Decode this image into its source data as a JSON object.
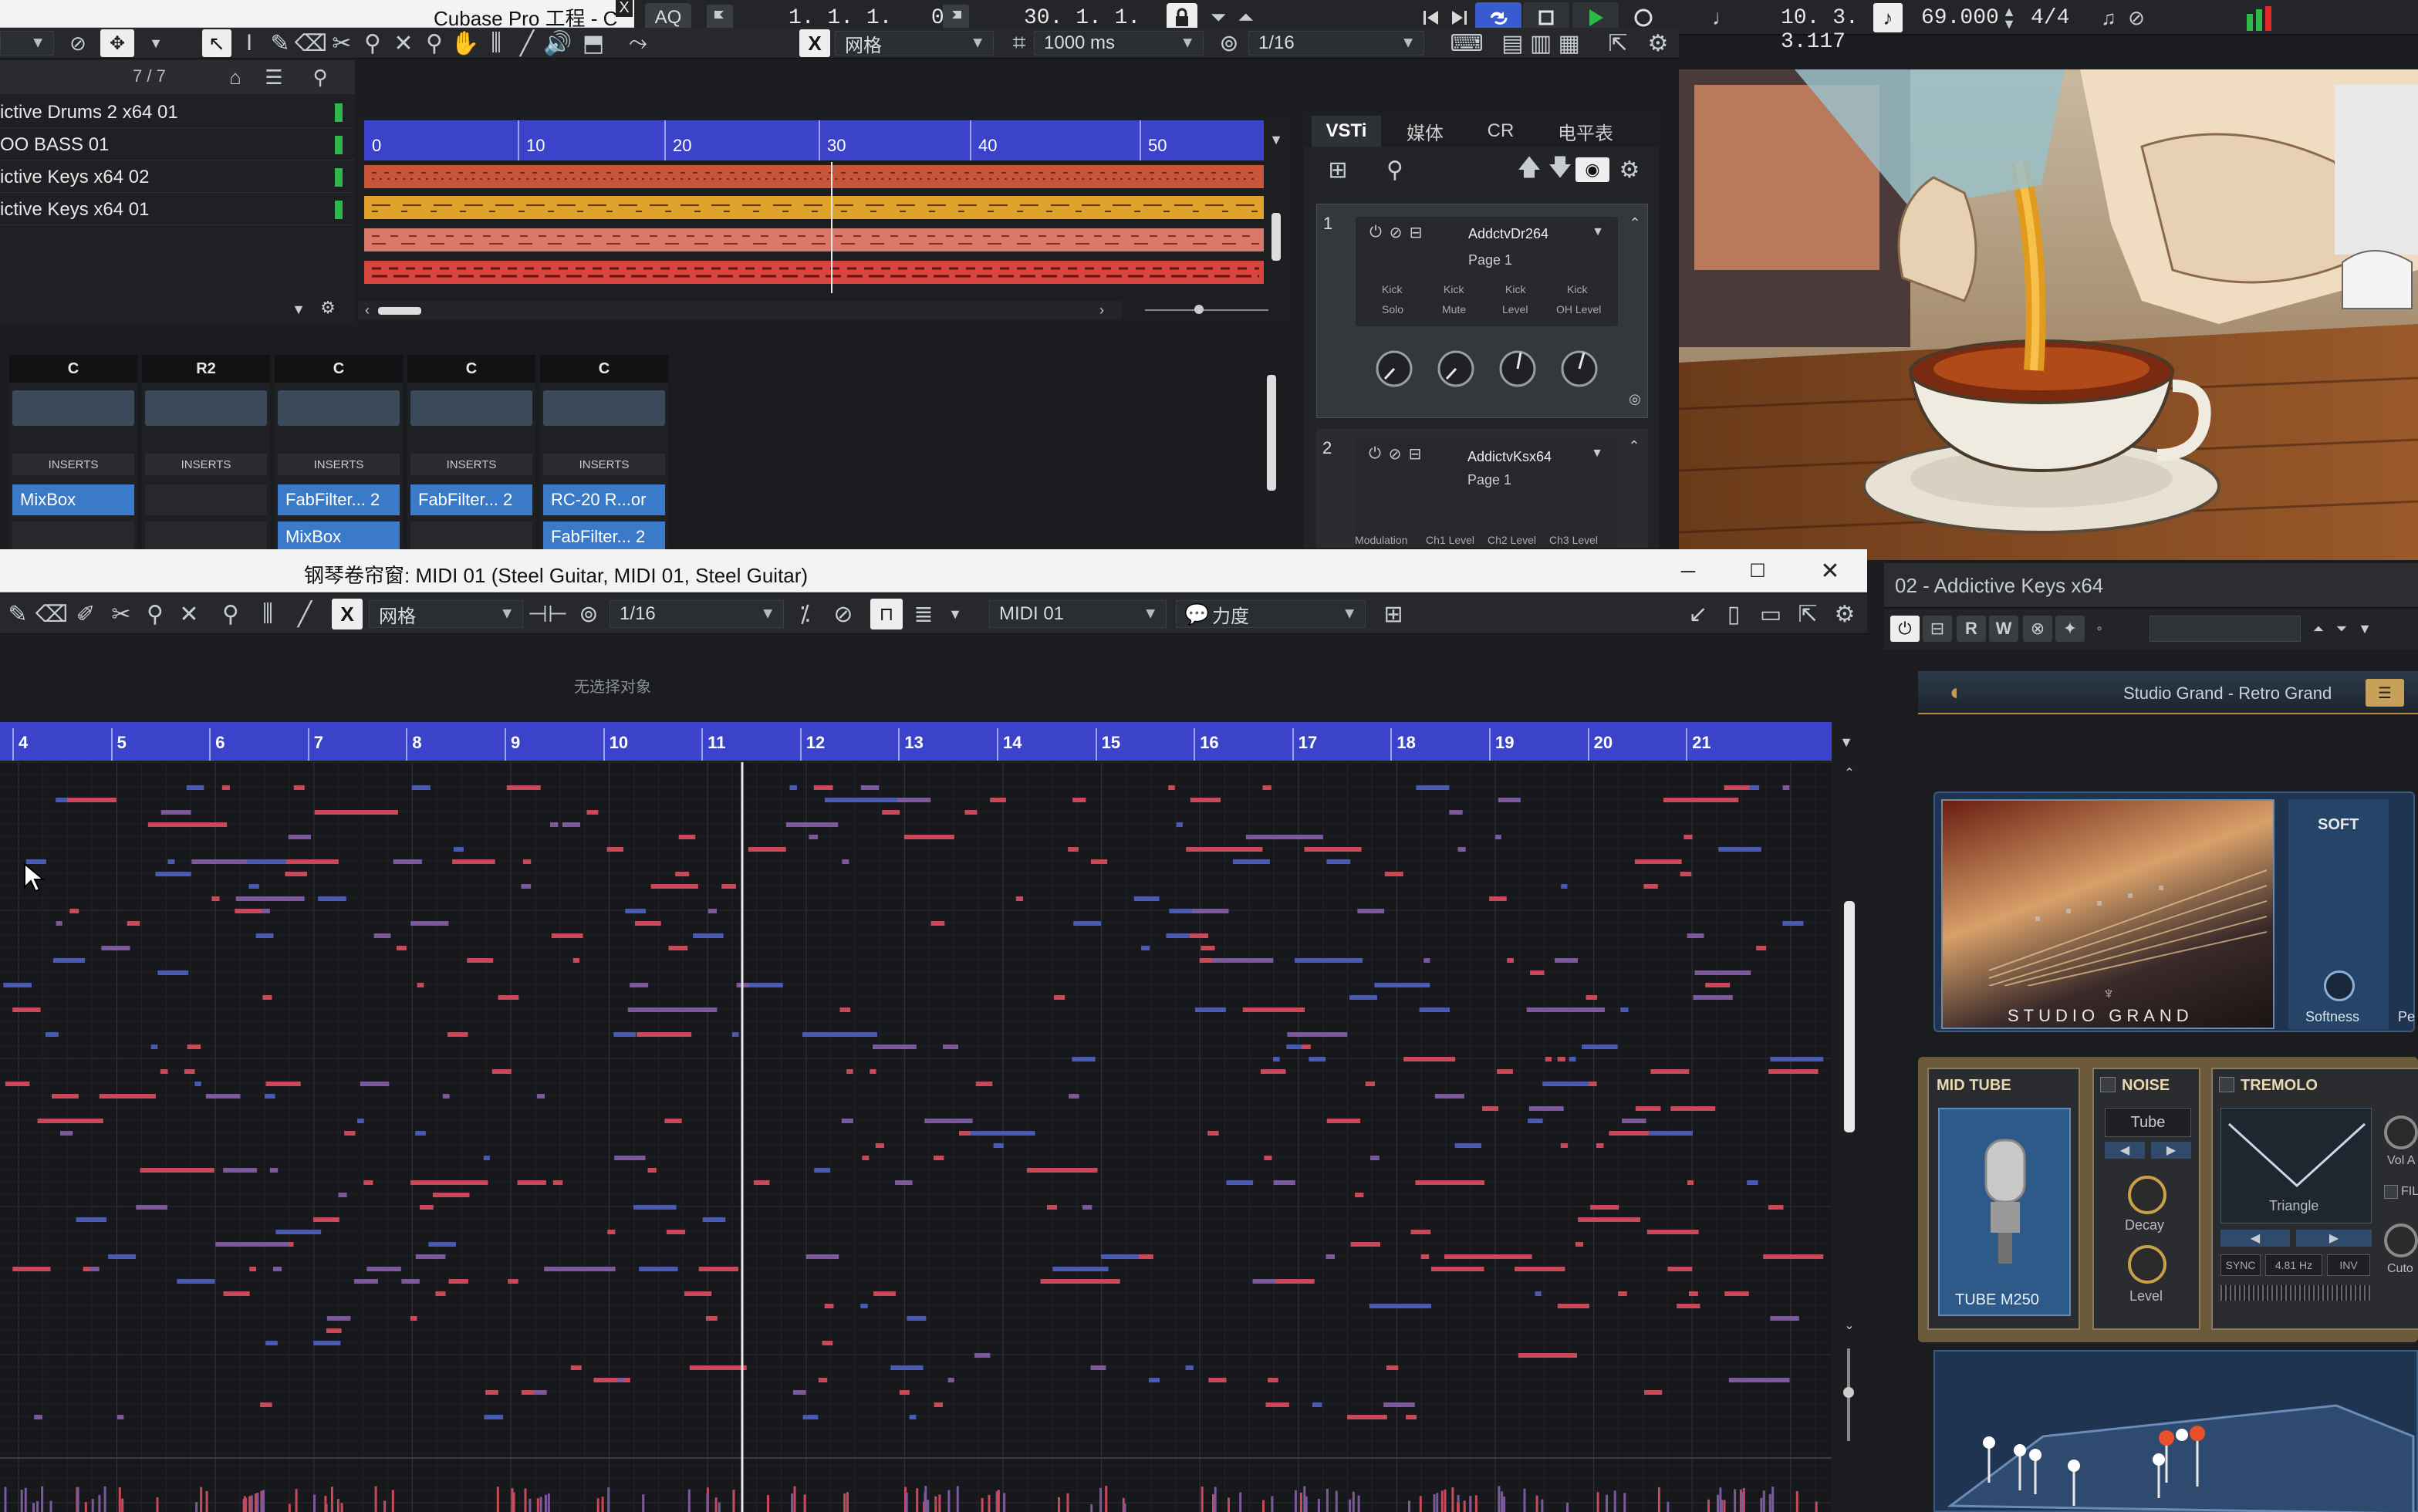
{
  "project_window": {
    "title": "Cubase Pro 工程 - C",
    "close_glyph": "X"
  },
  "transport": {
    "aq_label": "AQ",
    "left_locator": "1. 1. 1.   0",
    "right_locator": "30. 1. 1.   0",
    "position": "10. 3. 3.117",
    "tempo": "69.000",
    "signature": "4/4"
  },
  "project_toolbar": {
    "snap_type": "网格",
    "nudge": "1000 ms",
    "quantize": "1/16"
  },
  "track_list": {
    "counter": "7 / 7",
    "tracks": [
      {
        "name": "ictive Drums 2 x64 01"
      },
      {
        "name": "OO BASS 01"
      },
      {
        "name": "ictive Keys x64 02"
      },
      {
        "name": "ictive Keys x64 01"
      }
    ]
  },
  "ruler_top": {
    "marks": [
      "0",
      "10",
      "20",
      "30",
      "40",
      "50"
    ]
  },
  "mixer": {
    "channels": [
      {
        "pan": "C",
        "inserts_label": "INSERTS",
        "slots": [
          "MixBox",
          "",
          ""
        ]
      },
      {
        "pan": "R2",
        "inserts_label": "INSERTS",
        "slots": [
          "",
          "",
          ""
        ]
      },
      {
        "pan": "C",
        "inserts_label": "INSERTS",
        "slots": [
          "FabFilter... 2",
          "MixBox",
          ""
        ]
      },
      {
        "pan": "C",
        "inserts_label": "INSERTS",
        "slots": [
          "FabFilter... 2",
          "",
          ""
        ]
      },
      {
        "pan": "C",
        "inserts_label": "INSERTS",
        "slots": [
          "RC-20 R...or",
          "FabFilter... 2",
          ""
        ]
      }
    ]
  },
  "vsti_rack": {
    "tabs": [
      "VSTi",
      "媒体",
      "CR",
      "电平表"
    ],
    "slots": [
      {
        "index": "1",
        "name": "AddctvDr264",
        "page": "Page 1",
        "param_top": [
          "Kick",
          "Kick",
          "Kick",
          "Kick"
        ],
        "param_bottom": [
          "Solo",
          "Mute",
          "Level",
          "OH Level"
        ]
      },
      {
        "index": "2",
        "name": "AddictvKsx64",
        "page": "Page 1",
        "param_bottom": [
          "Modulation",
          "Ch1 Level",
          "Ch2 Level",
          "Ch3 Level"
        ]
      }
    ]
  },
  "piano_roll": {
    "title": "钢琴卷帘窗: MIDI 01 (Steel Guitar, MIDI 01, Steel Guitar)",
    "snap_type": "网格",
    "quantize": "1/16",
    "track": "MIDI 01",
    "controller": "力度",
    "status": "无选择对象",
    "bars": [
      "4",
      "5",
      "6",
      "7",
      "8",
      "9",
      "10",
      "11",
      "12",
      "13",
      "14",
      "15",
      "16",
      "17",
      "18",
      "19",
      "20",
      "21"
    ]
  },
  "keys_plugin": {
    "window_title": "02 - Addictive Keys x64",
    "preset": "Studio Grand - Retro Grand",
    "instrument_label": "STUDIO GRAND",
    "soft_label": "SOFT",
    "softness_label": "Softness",
    "pe_label": "Pe",
    "mid_tube_title": "MID TUBE",
    "mic_name": "TUBE M250",
    "noise_title": "NOISE",
    "noise_type": "Tube",
    "decay_label": "Decay",
    "level_label": "Level",
    "tremolo_title": "TREMOLO",
    "tremolo_shape": "Triangle",
    "sync_label": "SYNC",
    "rate": "4.81 Hz",
    "inv_label": "INV",
    "vol_label": "Vol A",
    "filter_label": "FIL",
    "cut_label": "Cuto",
    "rw_labels": [
      "R",
      "W"
    ]
  },
  "colors": {
    "ruler_blue": "#3a43c9",
    "drum_track": "#c8553a",
    "bass_track": "#e0a12a",
    "keys_track_1": "#d9776b",
    "keys_track_2": "#d6453e",
    "insert_slot": "#3a7ac8",
    "note_red": "#c84a5a",
    "note_purple": "#7a5a9a",
    "note_blue": "#4a5ab0",
    "play_green": "#2fb84a",
    "cycle_blue": "#3a5ad0"
  }
}
